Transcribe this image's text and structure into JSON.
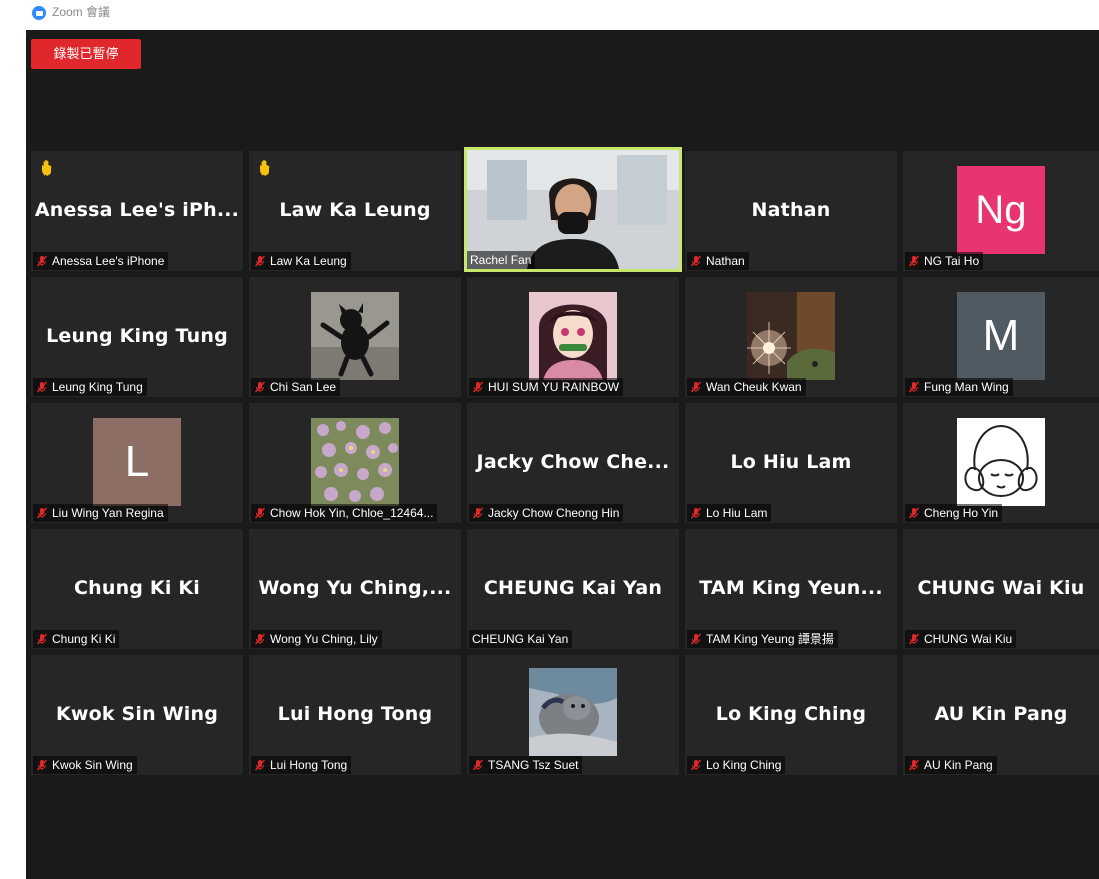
{
  "window": {
    "title": "Zoom 會議"
  },
  "recording_badge": "錄製已暫停",
  "colors": {
    "background": "#1a1a1a",
    "tile": "#262626",
    "active_speaker_border": "#c5e86c",
    "recording_red": "#e0282c",
    "mic_off_red": "#e02828",
    "raised_hand": "#f4c20d"
  },
  "participants": [
    {
      "display_name": "Anessa Lee's iPh...",
      "label": "Anessa Lee's iPhone",
      "muted": true,
      "hand_raised": true
    },
    {
      "display_name": "Law Ka Leung",
      "label": "Law Ka Leung",
      "muted": true,
      "hand_raised": true
    },
    {
      "display_name": "",
      "label": "Rachel Fan",
      "muted": false,
      "video": true,
      "active_speaker": true
    },
    {
      "display_name": "Nathan",
      "label": "Nathan",
      "muted": true
    },
    {
      "display_name": "",
      "label": "NG Tai Ho",
      "muted": true,
      "avatar_text": "Ng",
      "avatar_color": "#e8356f"
    },
    {
      "display_name": "Leung King Tung",
      "label": "Leung King Tung",
      "muted": true
    },
    {
      "display_name": "",
      "label": "Chi San Lee",
      "muted": true,
      "avatar_image": "black-cat-photo"
    },
    {
      "display_name": "",
      "label": "HUI SUM YU RAINBOW",
      "muted": true,
      "avatar_image": "anime-character-photo"
    },
    {
      "display_name": "",
      "label": "Wan Cheuk Kwan",
      "muted": true,
      "avatar_image": "sparkler-photo"
    },
    {
      "display_name": "",
      "label": "Fung Man Wing",
      "muted": true,
      "avatar_text": "M",
      "avatar_color": "#4f5a63"
    },
    {
      "display_name": "",
      "label": "Liu Wing Yan Regina",
      "muted": true,
      "avatar_text": "L",
      "avatar_color": "#8c6e65"
    },
    {
      "display_name": "",
      "label": "Chow Hok Yin, Chloe_12464...",
      "muted": true,
      "avatar_image": "flowers-photo"
    },
    {
      "display_name": "Jacky Chow Che...",
      "label": "Jacky Chow Cheong Hin",
      "muted": true
    },
    {
      "display_name": "Lo Hiu Lam",
      "label": "Lo Hiu Lam",
      "muted": true
    },
    {
      "display_name": "",
      "label": "Cheng Ho Yin",
      "muted": true,
      "avatar_image": "line-drawing-face"
    },
    {
      "display_name": "Chung Ki Ki",
      "label": "Chung Ki Ki",
      "muted": true
    },
    {
      "display_name": "Wong Yu Ching,...",
      "label": "Wong Yu Ching, Lily",
      "muted": true
    },
    {
      "display_name": "CHEUNG Kai Yan",
      "label": "CHEUNG Kai Yan",
      "muted": false
    },
    {
      "display_name": "TAM King Yeun...",
      "label": "TAM King Yeung 譚景揚",
      "muted": true
    },
    {
      "display_name": "CHUNG Wai Kiu",
      "label": "CHUNG Wai Kiu",
      "muted": true
    },
    {
      "display_name": "Kwok Sin Wing",
      "label": "Kwok Sin Wing",
      "muted": true
    },
    {
      "display_name": "Lui Hong Tong",
      "label": "Lui Hong Tong",
      "muted": true
    },
    {
      "display_name": "",
      "label": "TSANG Tsz Suet",
      "muted": true,
      "avatar_image": "grey-cat-photo"
    },
    {
      "display_name": "Lo King Ching",
      "label": "Lo King Ching",
      "muted": true
    },
    {
      "display_name": "AU Kin Pang",
      "label": "AU Kin Pang",
      "muted": true
    }
  ]
}
